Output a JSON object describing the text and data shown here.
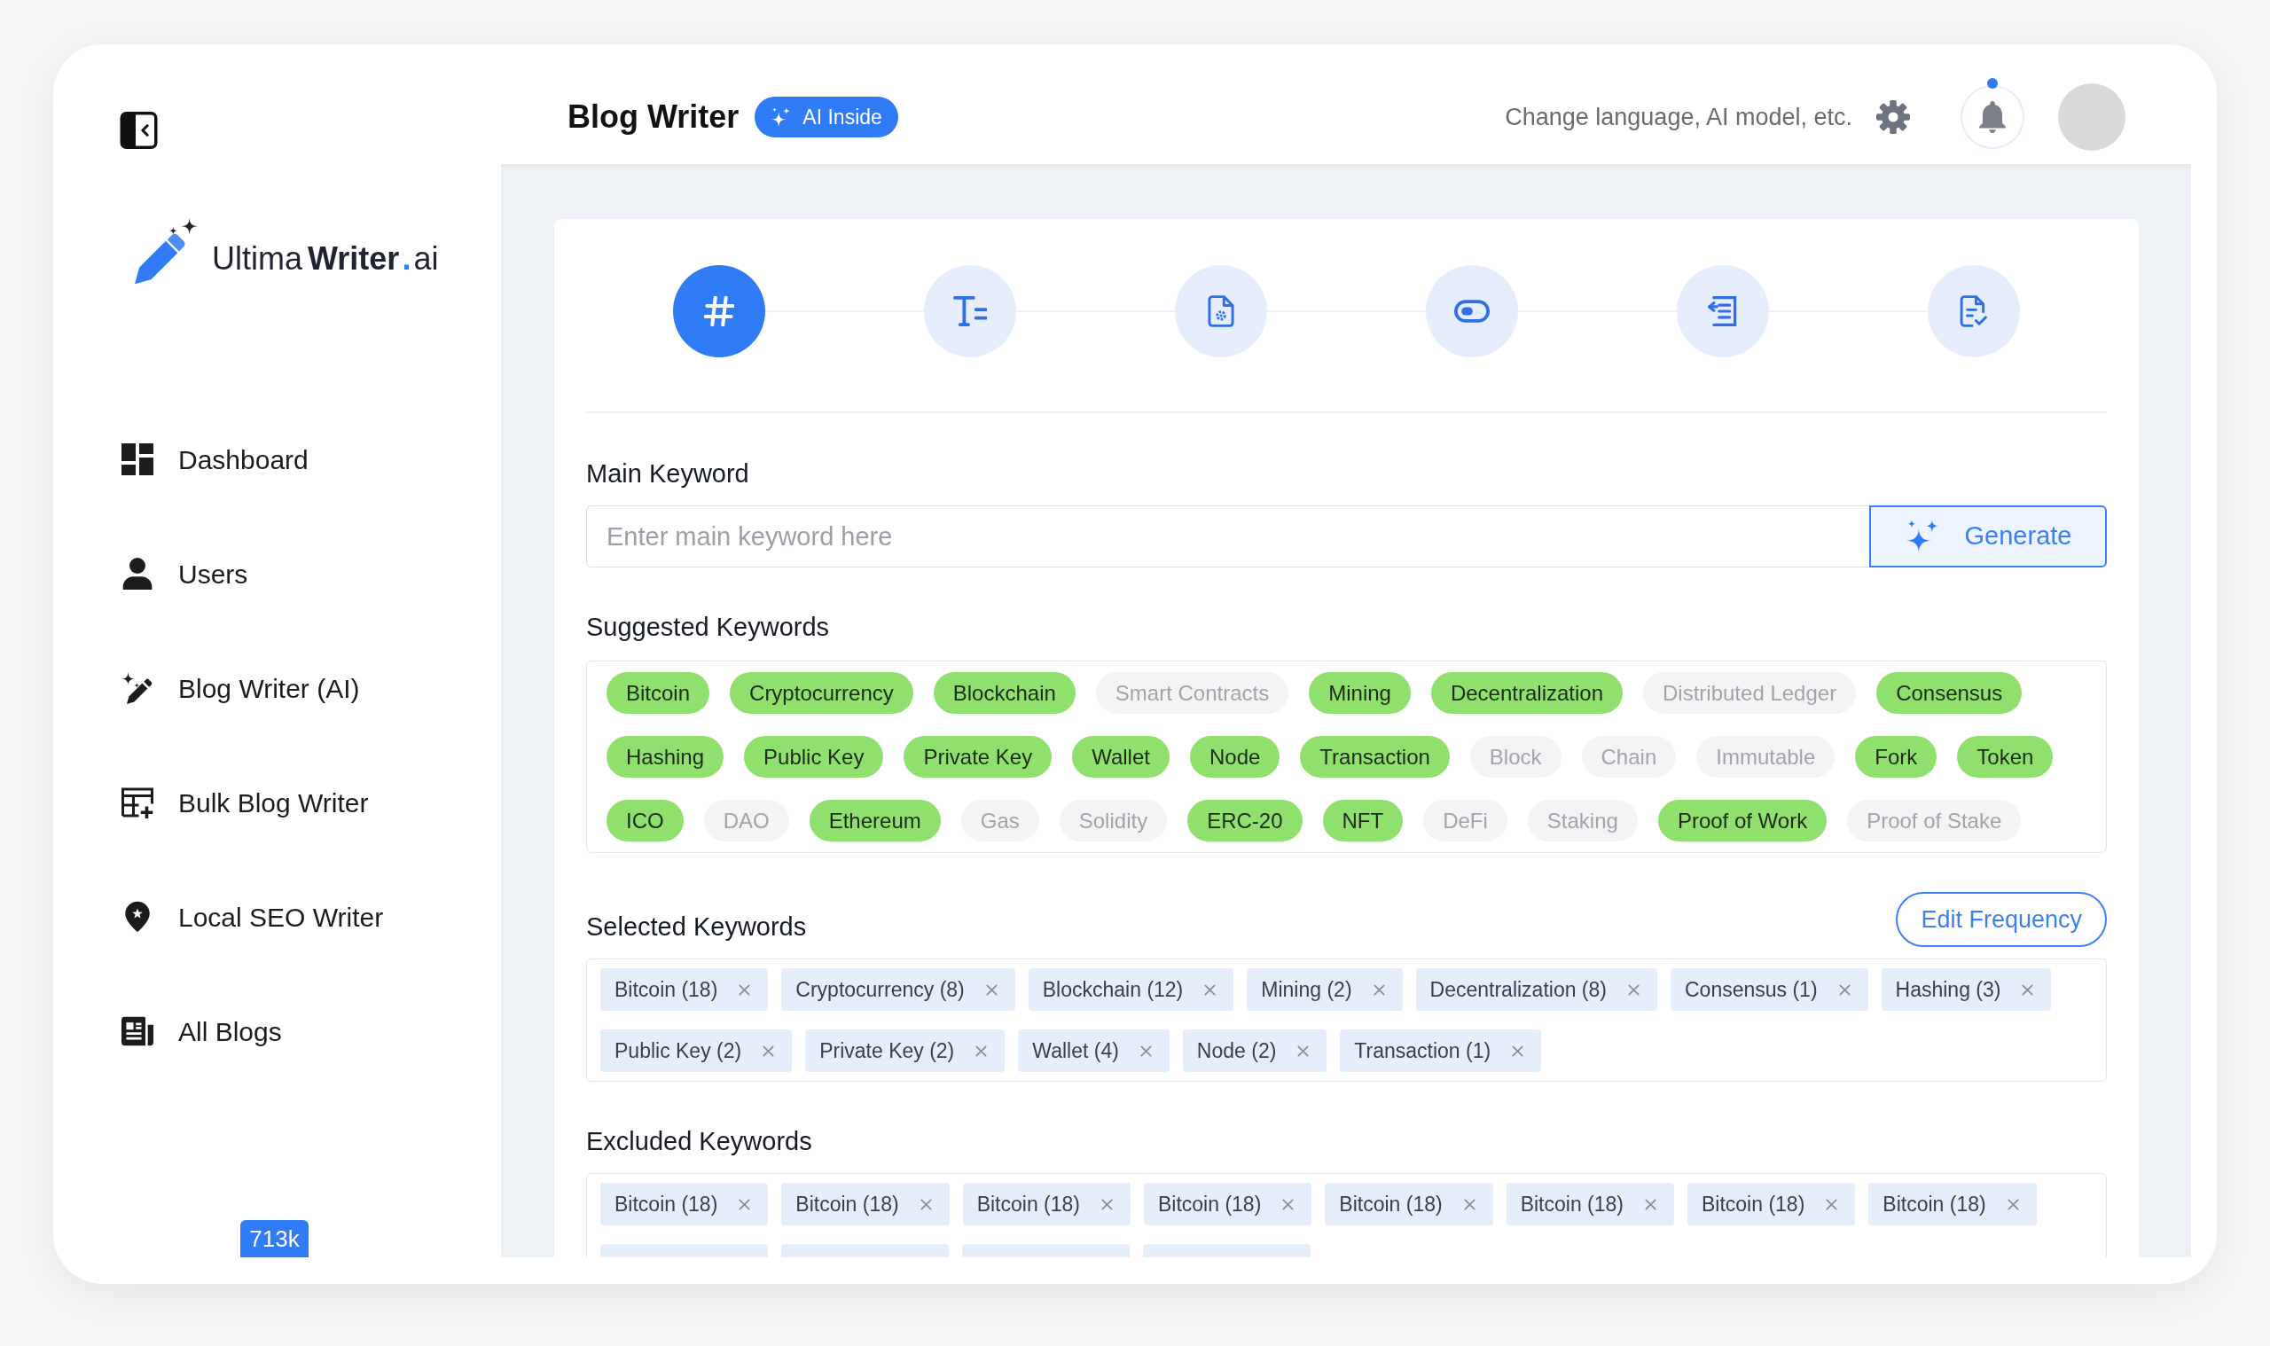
{
  "sidebar": {
    "logo": {
      "prefix": "Ultima",
      "name": "Writer",
      "dot": ".",
      "suffix": "ai"
    },
    "nav": [
      {
        "label": "Dashboard",
        "selected": false
      },
      {
        "label": "Users",
        "selected": false
      },
      {
        "label": "Blog Writer (AI)",
        "selected": false
      },
      {
        "label": "Bulk Blog Writer",
        "selected": false
      },
      {
        "label": "Local SEO Writer",
        "selected": false
      },
      {
        "label": "All Blogs",
        "selected": false
      }
    ],
    "credits": "713k"
  },
  "header": {
    "title": "Blog Writer",
    "badge": "AI Inside",
    "settings_hint": "Change language, AI model, etc.",
    "notifications": {
      "unread": true
    }
  },
  "steps": [
    {
      "selected": true
    },
    {
      "selected": false
    },
    {
      "selected": false
    },
    {
      "selected": false
    },
    {
      "selected": false
    },
    {
      "selected": false
    }
  ],
  "main_keyword": {
    "label": "Main Keyword",
    "placeholder": "Enter main keyword here",
    "button": "Generate"
  },
  "suggested_keywords": {
    "label": "Suggested Keywords",
    "items": [
      {
        "label": "Bitcoin",
        "selected": true
      },
      {
        "label": "Cryptocurrency",
        "selected": true
      },
      {
        "label": "Blockchain",
        "selected": true
      },
      {
        "label": "Smart Contracts",
        "selected": false
      },
      {
        "label": "Mining",
        "selected": true
      },
      {
        "label": "Decentralization",
        "selected": true
      },
      {
        "label": "Distributed Ledger",
        "selected": false
      },
      {
        "label": "Consensus",
        "selected": true
      },
      {
        "label": "Hashing",
        "selected": true
      },
      {
        "label": "Public Key",
        "selected": true
      },
      {
        "label": "Private Key",
        "selected": true
      },
      {
        "label": "Wallet",
        "selected": true
      },
      {
        "label": "Node",
        "selected": true
      },
      {
        "label": "Transaction",
        "selected": true
      },
      {
        "label": "Block",
        "selected": false
      },
      {
        "label": "Chain",
        "selected": false
      },
      {
        "label": "Immutable",
        "selected": false
      },
      {
        "label": "Fork",
        "selected": true
      },
      {
        "label": "Token",
        "selected": true
      },
      {
        "label": "ICO",
        "selected": true
      },
      {
        "label": "DAO",
        "selected": false
      },
      {
        "label": "Ethereum",
        "selected": true
      },
      {
        "label": "Gas",
        "selected": false
      },
      {
        "label": "Solidity",
        "selected": false
      },
      {
        "label": "ERC-20",
        "selected": true
      },
      {
        "label": "NFT",
        "selected": true
      },
      {
        "label": "DeFi",
        "selected": false
      },
      {
        "label": "Staking",
        "selected": false
      },
      {
        "label": "Proof of Work",
        "selected": true
      },
      {
        "label": "Proof of Stake",
        "selected": false
      }
    ]
  },
  "selected_keywords": {
    "label": "Selected Keywords",
    "action": "Edit Frequency",
    "items": [
      "Bitcoin (18)",
      "Cryptocurrency (8)",
      "Blockchain (12)",
      "Mining (2)",
      "Decentralization (8)",
      "Consensus (1)",
      "Hashing (3)",
      "Public Key (2)",
      "Private Key (2)",
      "Wallet (4)",
      "Node (2)",
      "Transaction (1)"
    ]
  },
  "excluded_keywords": {
    "label": "Excluded Keywords",
    "items": [
      {
        "kind": "tag",
        "label": "Bitcoin (18)"
      },
      {
        "kind": "tag",
        "label": "Bitcoin (18)"
      },
      {
        "kind": "tag",
        "label": "Bitcoin (18)"
      },
      {
        "kind": "tag",
        "label": "Bitcoin (18)"
      },
      {
        "kind": "tag",
        "label": "Bitcoin (18)"
      },
      {
        "kind": "tag",
        "label": "Bitcoin (18)"
      },
      {
        "kind": "tag",
        "label": "Bitcoin (18)"
      },
      {
        "kind": "tag",
        "label": "Bitcoin (18)"
      },
      {
        "kind": "cut"
      },
      {
        "kind": "cut"
      },
      {
        "kind": "cut"
      },
      {
        "kind": "cut"
      }
    ]
  }
}
